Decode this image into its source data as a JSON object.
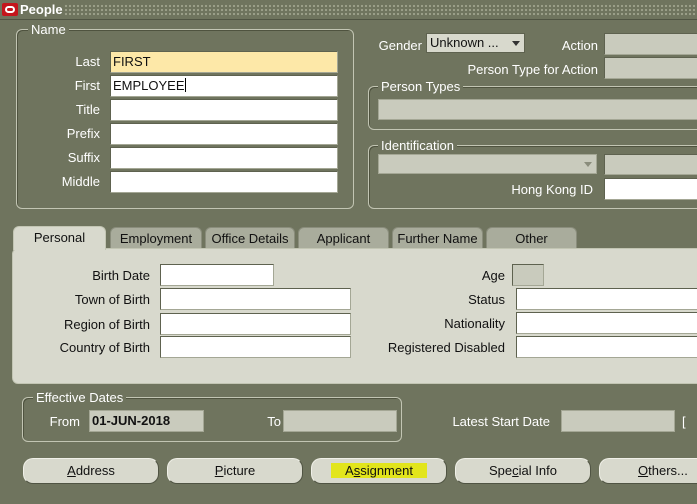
{
  "window": {
    "title": "People"
  },
  "name_section": {
    "legend": "Name",
    "fields": [
      {
        "label": "Last",
        "value": "FIRST"
      },
      {
        "label": "First",
        "value": "EMPLOYEE"
      },
      {
        "label": "Title",
        "value": ""
      },
      {
        "label": "Prefix",
        "value": ""
      },
      {
        "label": "Suffix",
        "value": ""
      },
      {
        "label": "Middle",
        "value": ""
      }
    ]
  },
  "gender": {
    "label": "Gender",
    "value": "Unknown ..."
  },
  "action": {
    "label": "Action",
    "value": ""
  },
  "person_type_for_action": {
    "label": "Person Type for Action",
    "value": ""
  },
  "person_types": {
    "legend": "Person Types",
    "value": ""
  },
  "identification": {
    "legend": "Identification",
    "hk_label": "Hong Kong ID",
    "hk_value": ""
  },
  "tabs": [
    "Personal",
    "Employment",
    "Office Details",
    "Applicant",
    "Further Name",
    "Other"
  ],
  "personal": {
    "birth_date": {
      "label": "Birth Date",
      "value": ""
    },
    "town_of_birth": {
      "label": "Town of Birth",
      "value": ""
    },
    "region_of_birth": {
      "label": "Region of Birth",
      "value": ""
    },
    "country_of_birth": {
      "label": "Country of Birth",
      "value": ""
    },
    "age": {
      "label": "Age",
      "value": ""
    },
    "status": {
      "label": "Status",
      "value": ""
    },
    "nationality": {
      "label": "Nationality",
      "value": ""
    },
    "registered_disabled": {
      "label": "Registered Disabled",
      "value": ""
    }
  },
  "effective_dates": {
    "legend": "Effective Dates",
    "from_label": "From",
    "from_value": "01-JUN-2018",
    "to_label": "To",
    "to_value": ""
  },
  "latest_start_date": {
    "label": "Latest Start Date",
    "value": "",
    "bracket": "["
  },
  "buttons": {
    "address": {
      "u": "A",
      "rest": "ddress"
    },
    "picture": {
      "u": "P",
      "rest": "icture"
    },
    "assignment": {
      "pre": "A",
      "u": "s",
      "rest": "signment"
    },
    "special_info": {
      "pre": "Spe",
      "u": "c",
      "rest": "ial Info"
    },
    "others": {
      "u": "O",
      "rest": "thers..."
    }
  },
  "colors": {
    "background": "#6f745e",
    "highlight": "#e2e51c",
    "required_field": "#fde8a8"
  }
}
